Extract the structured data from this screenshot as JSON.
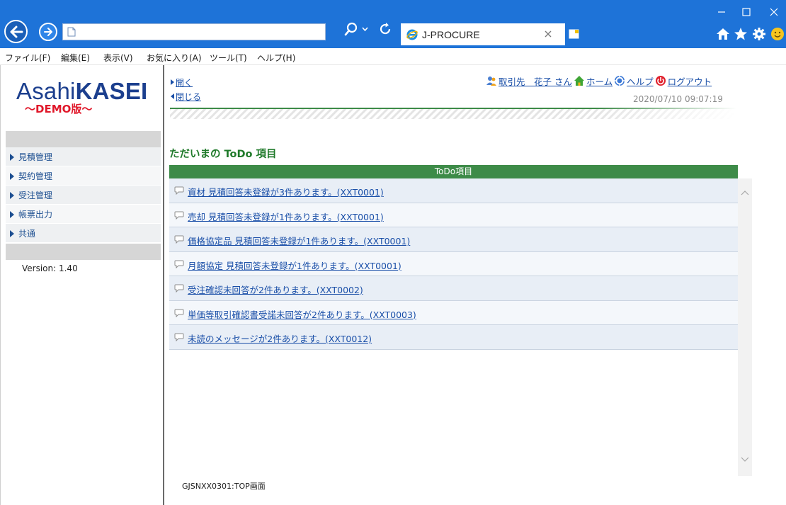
{
  "browser": {
    "tab_title": "J-PROCURE"
  },
  "menu": {
    "items": [
      "ファイル(F)",
      "編集(E)",
      "表示(V)",
      "お気に入り(A)",
      "ツール(T)",
      "ヘルプ(H)"
    ]
  },
  "sidebar": {
    "logo_light": "Asahi",
    "logo_bold": "KASEI",
    "logo_sub": "〜DEMO版〜",
    "items": [
      "見積管理",
      "契約管理",
      "受注管理",
      "帳票出力",
      "共通"
    ],
    "version": "Version: 1.40"
  },
  "header": {
    "open": "開く",
    "close": "閉じる",
    "user": "取引先　花子 さん",
    "home": "ホーム",
    "help": "ヘルプ",
    "logout": "ログアウト",
    "datetime": "2020/07/10 09:07:19"
  },
  "todo": {
    "title": "ただいまの ToDo 項目",
    "column": "ToDo項目",
    "items": [
      "資材 見積回答未登録が3件あります。(XXT0001)",
      "売却 見積回答未登録が1件あります。(XXT0001)",
      "価格協定品 見積回答未登録が1件あります。(XXT0001)",
      "月額協定 見積回答未登録が1件あります。(XXT0001)",
      "受注確認未回答が2件あります。(XXT0002)",
      "単価等取引確認書受諾未回答が2件あります。(XXT0003)",
      "未読のメッセージが2件あります。(XXT0012)"
    ]
  },
  "footer": {
    "screen_id": "GJSNXX0301:TOP画面"
  },
  "colors": {
    "titlebar": "#1e73d8",
    "todo_header": "#3d8b48",
    "todo_title": "#1f7a2a",
    "link": "#1a4fa8",
    "logo_blue": "#1c3f8e",
    "logo_red": "#e0182a"
  },
  "icons": {
    "back": "arrow-left-icon",
    "forward": "arrow-right-icon",
    "search": "search-icon",
    "refresh": "refresh-icon",
    "ie": "ie-icon",
    "home": "home-icon",
    "favorites": "star-icon",
    "settings": "gear-icon",
    "feedback": "smiley-icon",
    "user": "user-icon",
    "help": "help-icon",
    "logout": "logout-icon",
    "todo_item": "speech-bubble-icon"
  }
}
